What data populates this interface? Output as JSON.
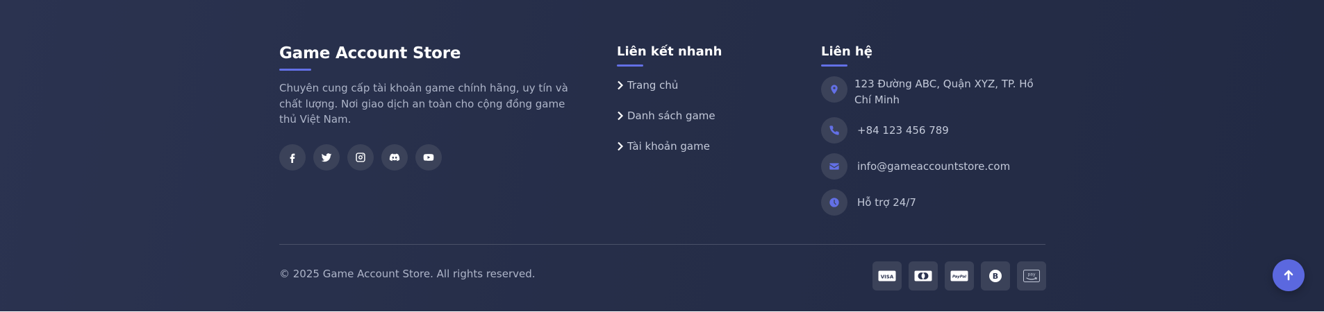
{
  "about": {
    "title": "Game Account Store",
    "description": "Chuyên cung cấp tài khoản game chính hãng, uy tín và chất lượng. Nơi giao dịch an toàn cho cộng đồng game thủ Việt Nam.",
    "socials": [
      "facebook-icon",
      "twitter-icon",
      "instagram-icon",
      "discord-icon",
      "youtube-icon"
    ]
  },
  "quick_links": {
    "title": "Liên kết nhanh",
    "items": [
      "Trang chủ",
      "Danh sách game",
      "Tài khoản game"
    ]
  },
  "contact": {
    "title": "Liên hệ",
    "address": "123 Đường ABC, Quận XYZ, TP. Hồ Chí Minh",
    "phone": "+84 123 456 789",
    "email": "info@gameaccountstore.com",
    "hours": "Hỗ trợ 24/7"
  },
  "copyright": "© 2025 Game Account Store. All rights reserved.",
  "payments": [
    "visa-icon",
    "mastercard-icon",
    "paypal-icon",
    "bitcoin-icon",
    "amazon-pay-icon"
  ],
  "colors": {
    "background": "#262e49",
    "accent": "#6370e6",
    "icon_bg": "#3b4259",
    "text_muted": "#aeb5c9"
  }
}
